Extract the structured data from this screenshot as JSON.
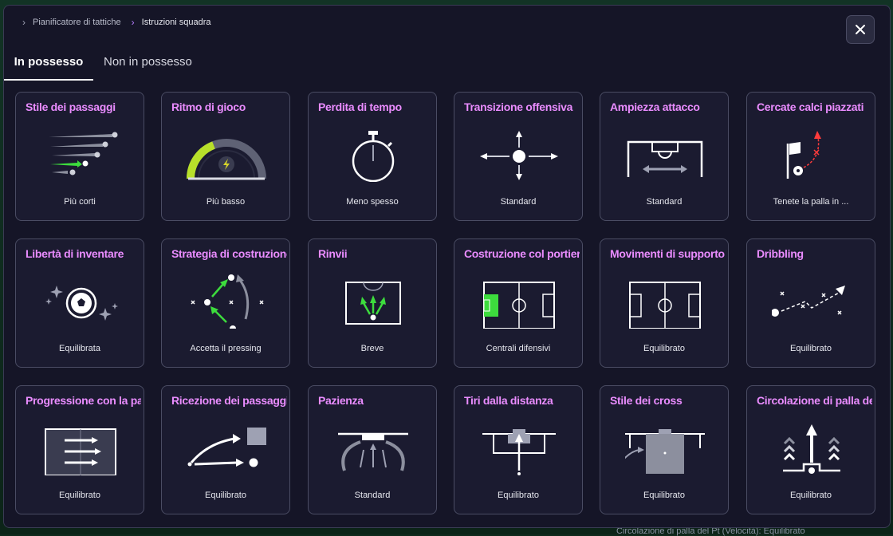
{
  "background": {
    "footer_text": "Circolazione di palla del Pt (Velocità): Equilibrato"
  },
  "breadcrumb": {
    "items": [
      "Pianificatore di tattiche",
      "Istruzioni squadra"
    ]
  },
  "close_icon": "close-icon",
  "tabs": [
    {
      "label": "In possesso",
      "active": true
    },
    {
      "label": "Non in possesso",
      "active": false
    }
  ],
  "colors": {
    "title_accent": "#ea8cff",
    "highlight_green": "#3ddc3d",
    "alert_red": "#ff3b3b",
    "card_bg": "#1b1b30"
  },
  "cards": [
    {
      "title": "Stile dei passaggi",
      "value": "Più corti",
      "icon": "short-passes-icon"
    },
    {
      "title": "Ritmo di gioco",
      "value": "Più basso",
      "icon": "tempo-gauge-icon"
    },
    {
      "title": "Perdita di tempo",
      "value": "Meno spesso",
      "icon": "stopwatch-icon"
    },
    {
      "title": "Transizione offensiva",
      "value": "Standard",
      "icon": "transition-arrows-icon"
    },
    {
      "title": "Ampiezza attacco",
      "value": "Standard",
      "icon": "attack-width-icon"
    },
    {
      "title": "Cercate calci piazzati",
      "value": "Tenete la palla in ...",
      "icon": "set-piece-flag-icon"
    },
    {
      "title": "Libertà di inventare",
      "value": "Equilibrata",
      "icon": "creative-ball-icon"
    },
    {
      "title": "Strategia di costruzione",
      "value": "Accetta il pressing",
      "icon": "build-up-icon"
    },
    {
      "title": "Rinvii",
      "value": "Breve",
      "icon": "goal-kick-icon"
    },
    {
      "title": "Costruzione col portiere",
      "value": "Centrali difensivi",
      "icon": "keeper-distribution-icon"
    },
    {
      "title": "Movimenti di supporto",
      "value": "Equilibrato",
      "icon": "supporting-runs-icon"
    },
    {
      "title": "Dribbling",
      "value": "Equilibrato",
      "icon": "dribbling-icon"
    },
    {
      "title": "Progressione con la palla",
      "value": "Equilibrato",
      "icon": "progression-icon"
    },
    {
      "title": "Ricezione dei passaggi",
      "value": "Equilibrato",
      "icon": "pass-reception-icon"
    },
    {
      "title": "Pazienza",
      "value": "Standard",
      "icon": "patience-icon"
    },
    {
      "title": "Tiri dalla distanza",
      "value": "Equilibrato",
      "icon": "long-shots-icon"
    },
    {
      "title": "Stile dei cross",
      "value": "Equilibrato",
      "icon": "crossing-icon"
    },
    {
      "title": "Circolazione di palla del Pt",
      "value": "Equilibrato",
      "icon": "keeper-circulation-icon"
    }
  ]
}
